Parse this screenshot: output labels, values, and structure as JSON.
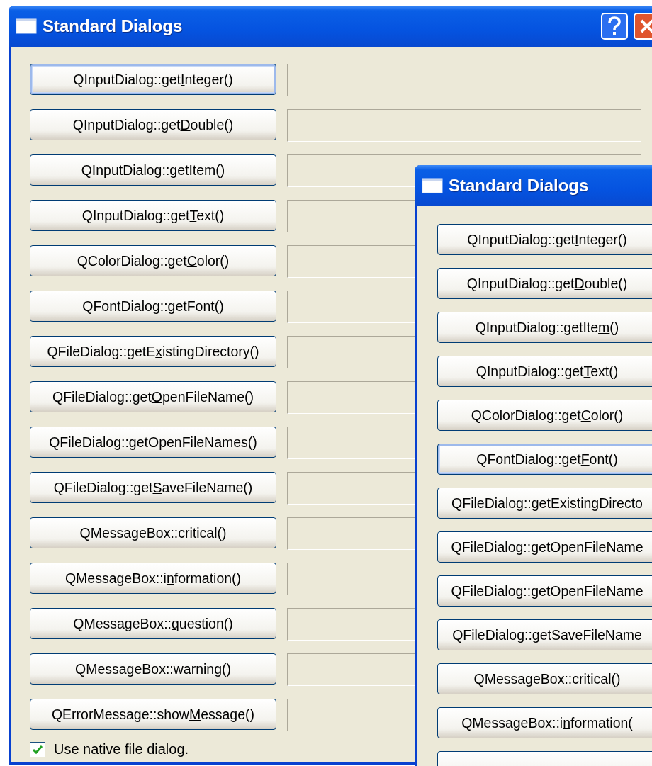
{
  "windows": [
    {
      "title": "Standard Dialogs",
      "title_buttons": true,
      "rows": [
        {
          "button": {
            "pre": "QInputDialog::get",
            "key": "I",
            "post": "nteger()",
            "focused": true
          },
          "has_field": true
        },
        {
          "button": {
            "pre": "QInputDialog::get",
            "key": "D",
            "post": "ouble()",
            "focused": false
          },
          "has_field": true
        },
        {
          "button": {
            "pre": "QInputDialog::getIte",
            "key": "m",
            "post": "()",
            "focused": false
          },
          "has_field": true
        },
        {
          "button": {
            "pre": "QInputDialog::get",
            "key": "T",
            "post": "ext()",
            "focused": false
          },
          "has_field": true
        },
        {
          "button": {
            "pre": "QColorDialog::get",
            "key": "C",
            "post": "olor()",
            "focused": false
          },
          "has_field": true
        },
        {
          "button": {
            "pre": "QFontDialog::get",
            "key": "F",
            "post": "ont()",
            "focused": false
          },
          "has_field": true
        },
        {
          "button": {
            "pre": "QFileDialog::getE",
            "key": "x",
            "post": "istingDirectory()",
            "focused": false
          },
          "has_field": true
        },
        {
          "button": {
            "pre": "QFileDialog::get",
            "key": "O",
            "post": "penFileName()",
            "focused": false
          },
          "has_field": true
        },
        {
          "button": {
            "pre": "QFileDialog::",
            "key": "g",
            "post": "etOpenFileNames()",
            "focused": false
          },
          "has_field": true
        },
        {
          "button": {
            "pre": "QFileDialog::get",
            "key": "S",
            "post": "aveFileName()",
            "focused": false
          },
          "has_field": true
        },
        {
          "button": {
            "pre": "QMessageBox::critica",
            "key": "l",
            "post": "()",
            "focused": false
          },
          "has_field": true
        },
        {
          "button": {
            "pre": "QMessageBox::i",
            "key": "n",
            "post": "formation()",
            "focused": false
          },
          "has_field": true
        },
        {
          "button": {
            "pre": "QMessageBox::",
            "key": "q",
            "post": "uestion()",
            "focused": false
          },
          "has_field": true
        },
        {
          "button": {
            "pre": "QMessageBox::",
            "key": "w",
            "post": "arning()",
            "focused": false
          },
          "has_field": true
        },
        {
          "button": {
            "pre": "QErrorMessage::show",
            "key": "M",
            "post": "essage()",
            "focused": false
          },
          "has_field": true
        }
      ],
      "checkbox": {
        "label": "Use native file dialog.",
        "checked": true
      }
    },
    {
      "title": "Standard Dialogs",
      "title_buttons": false,
      "rows": [
        {
          "button": {
            "pre": "QInputDialog::get",
            "key": "I",
            "post": "nteger()",
            "focused": false
          },
          "has_field": false
        },
        {
          "button": {
            "pre": "QInputDialog::get",
            "key": "D",
            "post": "ouble()",
            "focused": false
          },
          "has_field": false
        },
        {
          "button": {
            "pre": "QInputDialog::getIte",
            "key": "m",
            "post": "()",
            "focused": false
          },
          "has_field": false
        },
        {
          "button": {
            "pre": "QInputDialog::get",
            "key": "T",
            "post": "ext()",
            "focused": false
          },
          "has_field": false
        },
        {
          "button": {
            "pre": "QColorDialog::get",
            "key": "C",
            "post": "olor()",
            "focused": false
          },
          "has_field": false
        },
        {
          "button": {
            "pre": "QFontDialog::get",
            "key": "F",
            "post": "ont()",
            "focused": true
          },
          "has_field": false
        },
        {
          "button": {
            "pre": "QFileDialog::getE",
            "key": "x",
            "post": "istingDirecto",
            "focused": false
          },
          "has_field": false
        },
        {
          "button": {
            "pre": "QFileDialog::get",
            "key": "O",
            "post": "penFileName",
            "focused": false
          },
          "has_field": false
        },
        {
          "button": {
            "pre": "QFileDialog::",
            "key": "g",
            "post": "etOpenFileName",
            "focused": false
          },
          "has_field": false
        },
        {
          "button": {
            "pre": "QFileDialog::get",
            "key": "S",
            "post": "aveFileName",
            "focused": false
          },
          "has_field": false
        },
        {
          "button": {
            "pre": "QMessageBox::critica",
            "key": "l",
            "post": "()",
            "focused": false
          },
          "has_field": false
        },
        {
          "button": {
            "pre": "QMessageBox::i",
            "key": "n",
            "post": "formation(",
            "focused": false
          },
          "has_field": false
        },
        {
          "button": {
            "focused": false
          },
          "has_field": false
        }
      ]
    }
  ]
}
